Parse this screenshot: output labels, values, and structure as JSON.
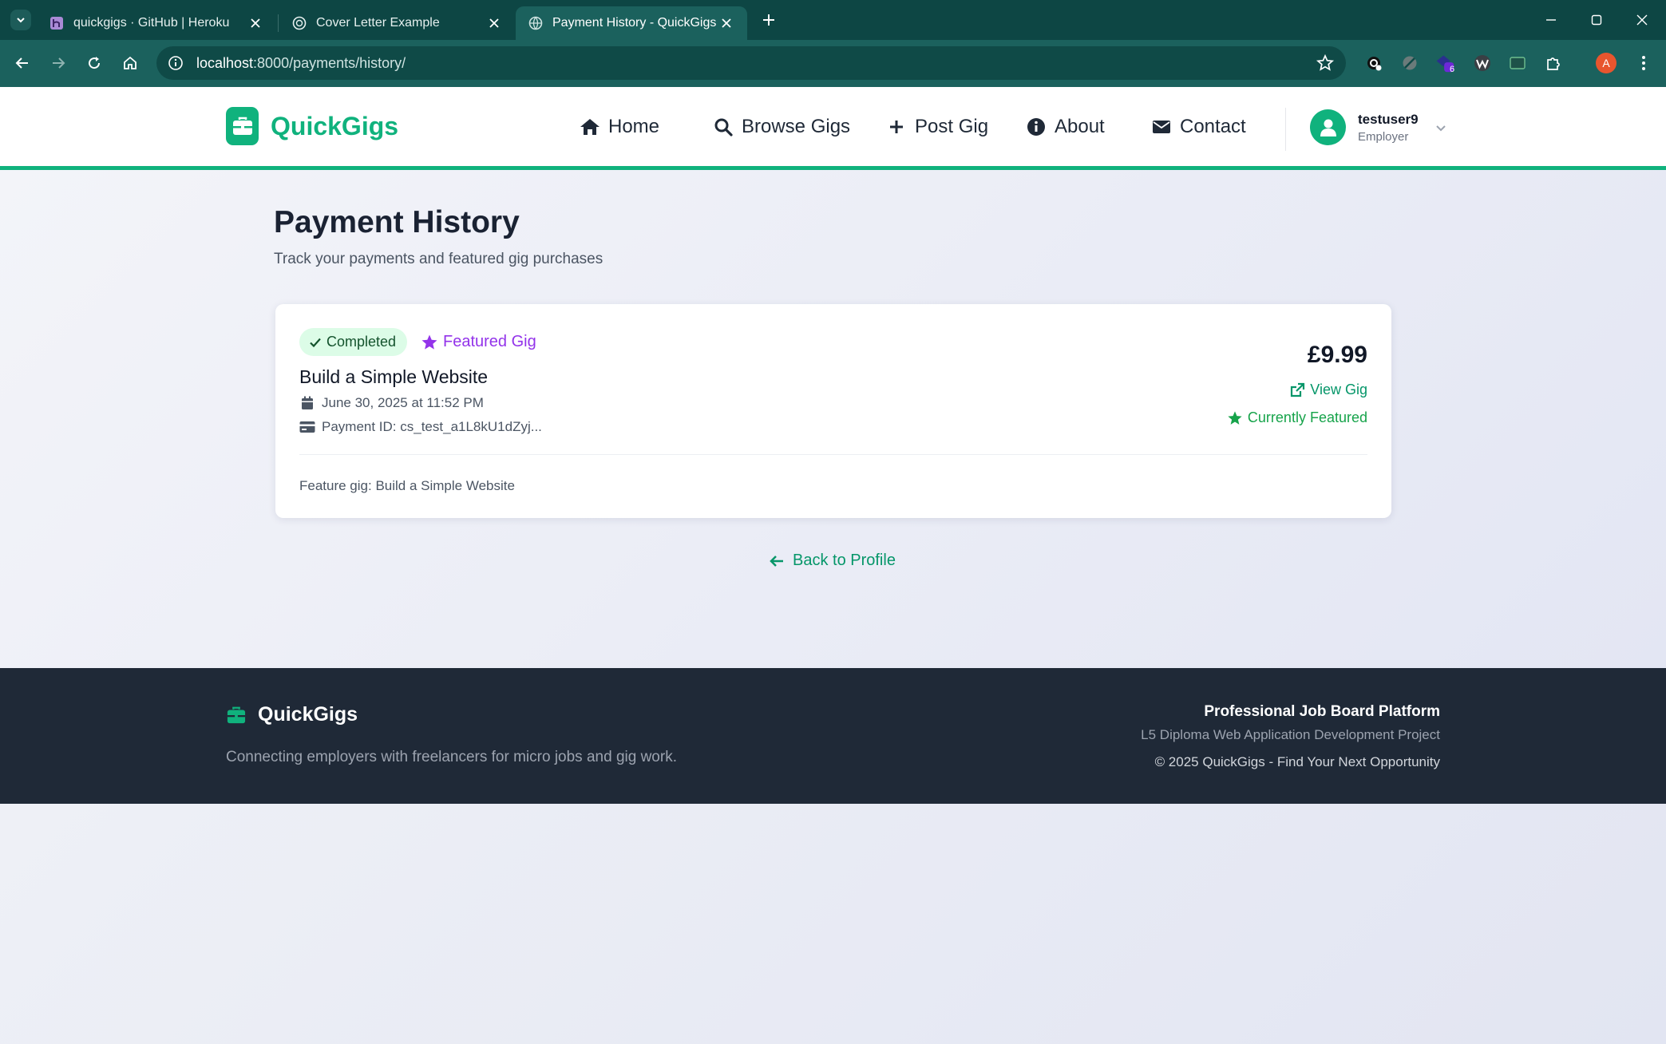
{
  "browser": {
    "tabs": [
      {
        "title": "quickgigs · GitHub | Heroku",
        "favicon": "heroku-icon"
      },
      {
        "title": "Cover Letter Example",
        "favicon": "chatgpt-icon"
      },
      {
        "title": "Payment History - QuickGigs",
        "favicon": "globe-icon"
      }
    ],
    "url_host": "localhost",
    "url_path": ":8000/payments/history/",
    "extension_badge": "6",
    "profile_initial": "A"
  },
  "site": {
    "brand": "QuickGigs",
    "nav": [
      {
        "label": "Home",
        "icon": "home-icon"
      },
      {
        "label": "Browse Gigs",
        "icon": "search-icon"
      },
      {
        "label": "Post Gig",
        "icon": "plus-icon"
      },
      {
        "label": "About",
        "icon": "info-icon"
      },
      {
        "label": "Contact",
        "icon": "envelope-icon"
      }
    ],
    "user": {
      "name": "testuser9",
      "role": "Employer"
    }
  },
  "page": {
    "title": "Payment History",
    "subtitle": "Track your payments and featured gig purchases",
    "back_label": "Back to Profile"
  },
  "payments": [
    {
      "status": "Completed",
      "type": "Featured Gig",
      "gig_title": "Build a Simple Website",
      "date": "June 30, 2025 at 11:52 PM",
      "payment_id": "Payment ID: cs_test_a1L8kU1dZyj...",
      "amount": "£9.99",
      "view_label": "View Gig",
      "featured_label": "Currently Featured",
      "description": "Feature gig: Build a Simple Website"
    }
  ],
  "footer": {
    "brand": "QuickGigs",
    "tagline": "Connecting employers with freelancers for micro jobs and gig work.",
    "heading": "Professional Job Board Platform",
    "subheading": "L5 Diploma Web Application Development Project",
    "copyright": "© 2025 QuickGigs - Find Your Next Opportunity"
  },
  "colors": {
    "brand": "#10b27d",
    "chrome_dark": "#0d4644",
    "chrome": "#1b615d",
    "footer": "#1f2937",
    "featured": "#9333ea",
    "success": "#16a34a"
  }
}
